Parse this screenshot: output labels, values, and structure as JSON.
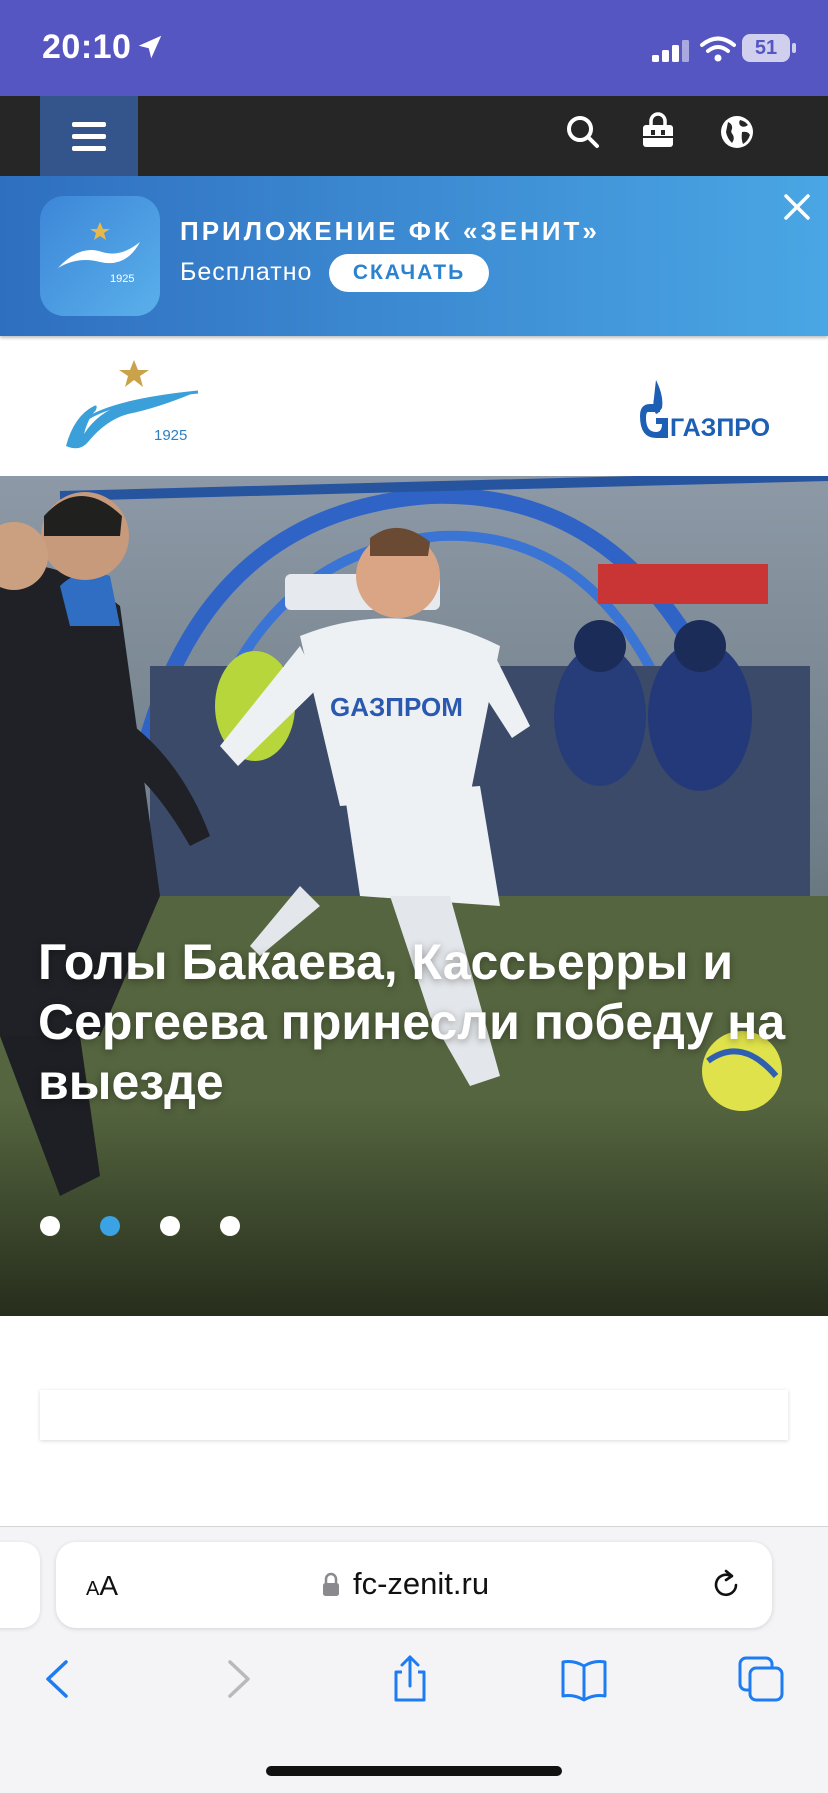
{
  "status_bar": {
    "time": "20:10",
    "battery": "51"
  },
  "banner": {
    "title": "ПРИЛОЖЕНИЕ ФК «ЗЕНИТ»",
    "subtitle": "Бесплатно",
    "download_label": "СКАЧАТЬ"
  },
  "hero": {
    "headline": "Голы Бакаева, Кассьерры и Сергеева принесли победу на выезде",
    "slides_total": 4,
    "active_slide": 2
  },
  "browser": {
    "text_size_label": "AA",
    "url": "fc-zenit.ru"
  },
  "colors": {
    "status_bar": "#5656c2",
    "nav_bar": "#262626",
    "menu_button": "#34558c",
    "banner_start": "#2f6fc0",
    "banner_end": "#4aa6e4",
    "accent_blue": "#2b82cf",
    "active_dot": "#3ba3e3",
    "safari_blue": "#1e7cf2"
  },
  "icons": [
    "location-arrow-icon",
    "signal-icon",
    "wifi-icon",
    "battery-icon",
    "menu-icon",
    "search-icon",
    "shop-icon",
    "globe-icon",
    "close-icon",
    "lock-icon",
    "reload-icon",
    "back-icon",
    "forward-icon",
    "share-icon",
    "bookmarks-icon",
    "tabs-icon"
  ]
}
